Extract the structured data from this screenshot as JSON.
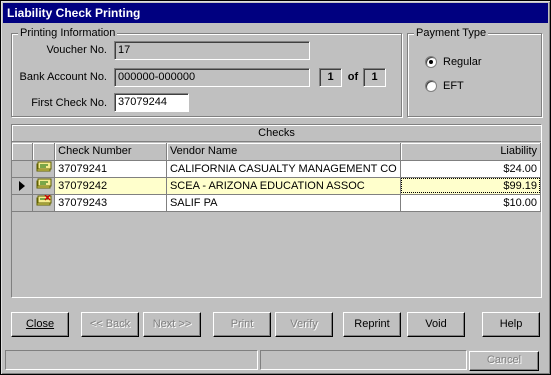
{
  "window": {
    "title": "Liability Check Printing"
  },
  "printing_info": {
    "group_title": "Printing Information",
    "voucher_label": "Voucher No.",
    "voucher_value": "17",
    "bank_label": "Bank Account No.",
    "bank_value": "000000-000000",
    "page_current": "1",
    "page_of": "of",
    "page_total": "1",
    "first_check_label": "First Check No.",
    "first_check_value": "37079244"
  },
  "payment_type": {
    "group_title": "Payment Type",
    "options": [
      {
        "label": "Regular",
        "selected": true
      },
      {
        "label": "EFT",
        "selected": false
      }
    ]
  },
  "checks_grid": {
    "caption": "Checks",
    "columns": [
      "Check Number",
      "Vendor Name",
      "Liability"
    ],
    "rows": [
      {
        "icon": "check-ok-icon",
        "check_number": "37079241",
        "vendor": "CALIFORNIA CASUALTY MANAGEMENT CO",
        "liability": "$24.00",
        "current": false
      },
      {
        "icon": "check-ok-icon",
        "check_number": "37079242",
        "vendor": "SCEA - ARIZONA EDUCATION ASSOC",
        "liability": "$99.19",
        "current": true
      },
      {
        "icon": "check-void-icon",
        "check_number": "37079243",
        "vendor": "SALIF PA",
        "liability": "$10.00",
        "current": false
      }
    ]
  },
  "buttons": {
    "close": "Close",
    "back": "<< Back",
    "next": "Next >>",
    "print": "Print",
    "verify": "Verify",
    "reprint": "Reprint",
    "void": "Void",
    "help": "Help",
    "cancel": "Cancel"
  },
  "colors": {
    "title_bar": "#000080",
    "face": "#c0c0c0",
    "current_row": "#ffffcc"
  }
}
